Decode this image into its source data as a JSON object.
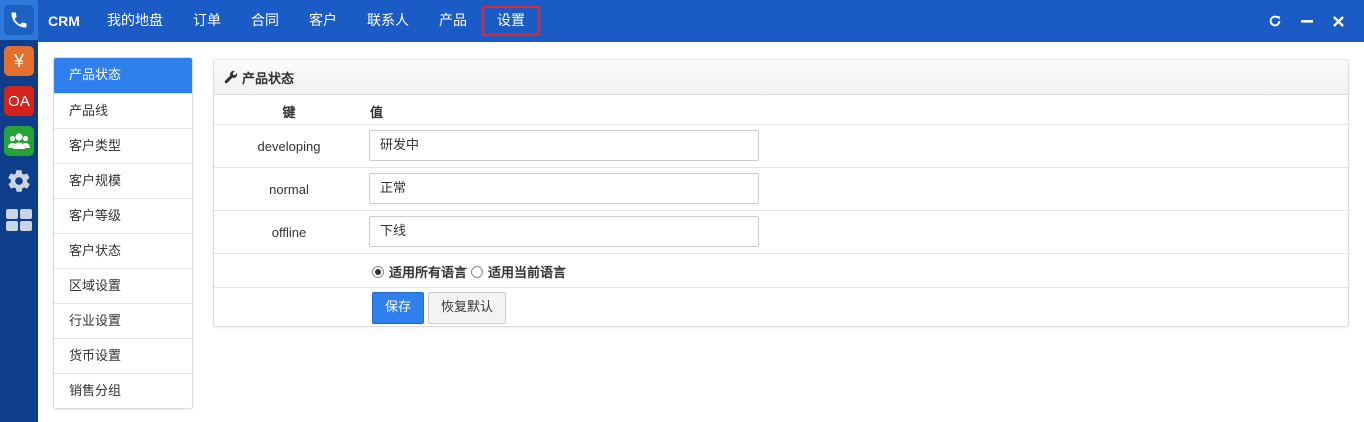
{
  "apps": [
    {
      "name": "phone-app",
      "icon": "phone-icon",
      "color": "#1b61c1"
    },
    {
      "name": "finance-app",
      "icon": "yen-icon",
      "label": "¥",
      "color": "#e2702e"
    },
    {
      "name": "oa-app",
      "label": "OA",
      "color": "#d4231d"
    },
    {
      "name": "team-app",
      "icon": "team-icon",
      "color": "#25a238"
    },
    {
      "name": "settings-app",
      "icon": "gear-icon"
    },
    {
      "name": "dashboard-app",
      "icon": "grid-icon"
    }
  ],
  "topbar": {
    "brand": "CRM",
    "nav": [
      "我的地盘",
      "订单",
      "合同",
      "客户",
      "联系人",
      "产品",
      "设置"
    ],
    "active_nav": "设置",
    "controls": [
      "refresh-icon",
      "minimize-icon",
      "close-icon"
    ]
  },
  "sidemenu": {
    "items": [
      "产品状态",
      "产品线",
      "客户类型",
      "客户规模",
      "客户等级",
      "客户状态",
      "区域设置",
      "行业设置",
      "货币设置",
      "销售分组"
    ],
    "active": "产品状态"
  },
  "panel": {
    "title": "产品状态",
    "col_key": "键",
    "col_value": "值",
    "rows": [
      {
        "key": "developing",
        "value": "研发中"
      },
      {
        "key": "normal",
        "value": "正常"
      },
      {
        "key": "offline",
        "value": "下线"
      }
    ],
    "lang_options": [
      {
        "label": "适用所有语言",
        "checked": true
      },
      {
        "label": "适用当前语言",
        "checked": false
      }
    ],
    "save_label": "保存",
    "reset_label": "恢复默认"
  },
  "colors": {
    "rail": "#0e3e89",
    "topbar": "#1a5bc5",
    "accent": "#2f80ed",
    "active_highlight": "#e0262e"
  }
}
